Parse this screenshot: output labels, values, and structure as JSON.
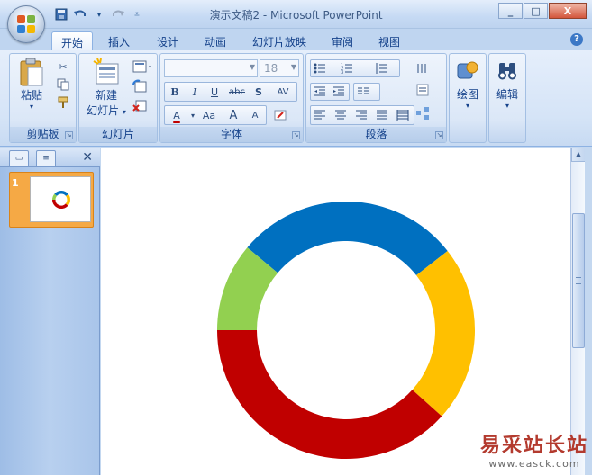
{
  "window": {
    "title": "演示文稿2 - Microsoft PowerPoint",
    "minimize": "_",
    "maximize": "□",
    "close": "X"
  },
  "quick_access": [
    "save-icon",
    "undo-icon",
    "redo-icon",
    "customize-icon"
  ],
  "tabs": [
    {
      "label": "开始",
      "active": true
    },
    {
      "label": "插入"
    },
    {
      "label": "设计"
    },
    {
      "label": "动画"
    },
    {
      "label": "幻灯片放映"
    },
    {
      "label": "审阅"
    },
    {
      "label": "视图"
    }
  ],
  "help": "?",
  "ribbon": {
    "clipboard": {
      "paste": "粘贴",
      "label": "剪贴板"
    },
    "slides": {
      "new_slide_line1": "新建",
      "new_slide_line2": "幻灯片",
      "label": "幻灯片"
    },
    "font": {
      "font_name": "",
      "font_size": "18",
      "bold": "B",
      "italic": "I",
      "underline": "U",
      "strike": "abc",
      "shadow": "S",
      "spacing": "AV",
      "font_color": "A",
      "change_case": "Aa",
      "grow": "A",
      "shrink": "A",
      "label": "字体"
    },
    "paragraph": {
      "label": "段落"
    },
    "drawing": {
      "label": "绘图"
    },
    "editing": {
      "label": "编辑"
    }
  },
  "panel": {
    "slide_number": "1",
    "close": "✕"
  },
  "chart_colors": {
    "blue": "#0070c0",
    "orange": "#ffc000",
    "red": "#c00000",
    "green": "#92d050"
  },
  "watermark": {
    "cn": "易采站长站",
    "url": "www.easck.com"
  }
}
